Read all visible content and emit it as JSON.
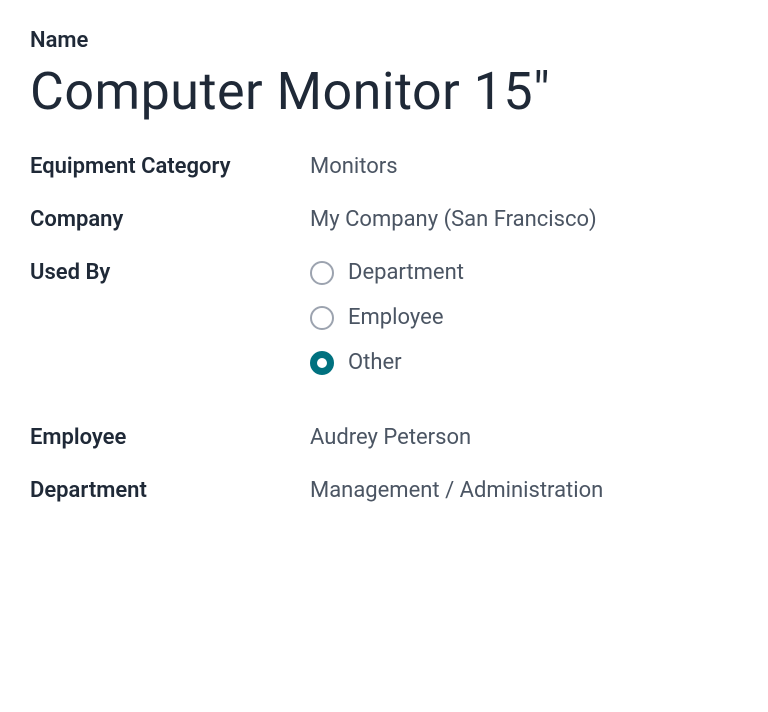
{
  "name_label": "Name",
  "name_value": "Computer Monitor 15\"",
  "fields": {
    "equipment_category": {
      "label": "Equipment Category",
      "value": "Monitors"
    },
    "company": {
      "label": "Company",
      "value": "My Company (San Francisco)"
    },
    "used_by": {
      "label": "Used By",
      "options": [
        {
          "label": "Department",
          "selected": false
        },
        {
          "label": "Employee",
          "selected": false
        },
        {
          "label": "Other",
          "selected": true
        }
      ]
    },
    "employee": {
      "label": "Employee",
      "value": "Audrey Peterson"
    },
    "department": {
      "label": "Department",
      "value": "Management / Administration"
    }
  }
}
